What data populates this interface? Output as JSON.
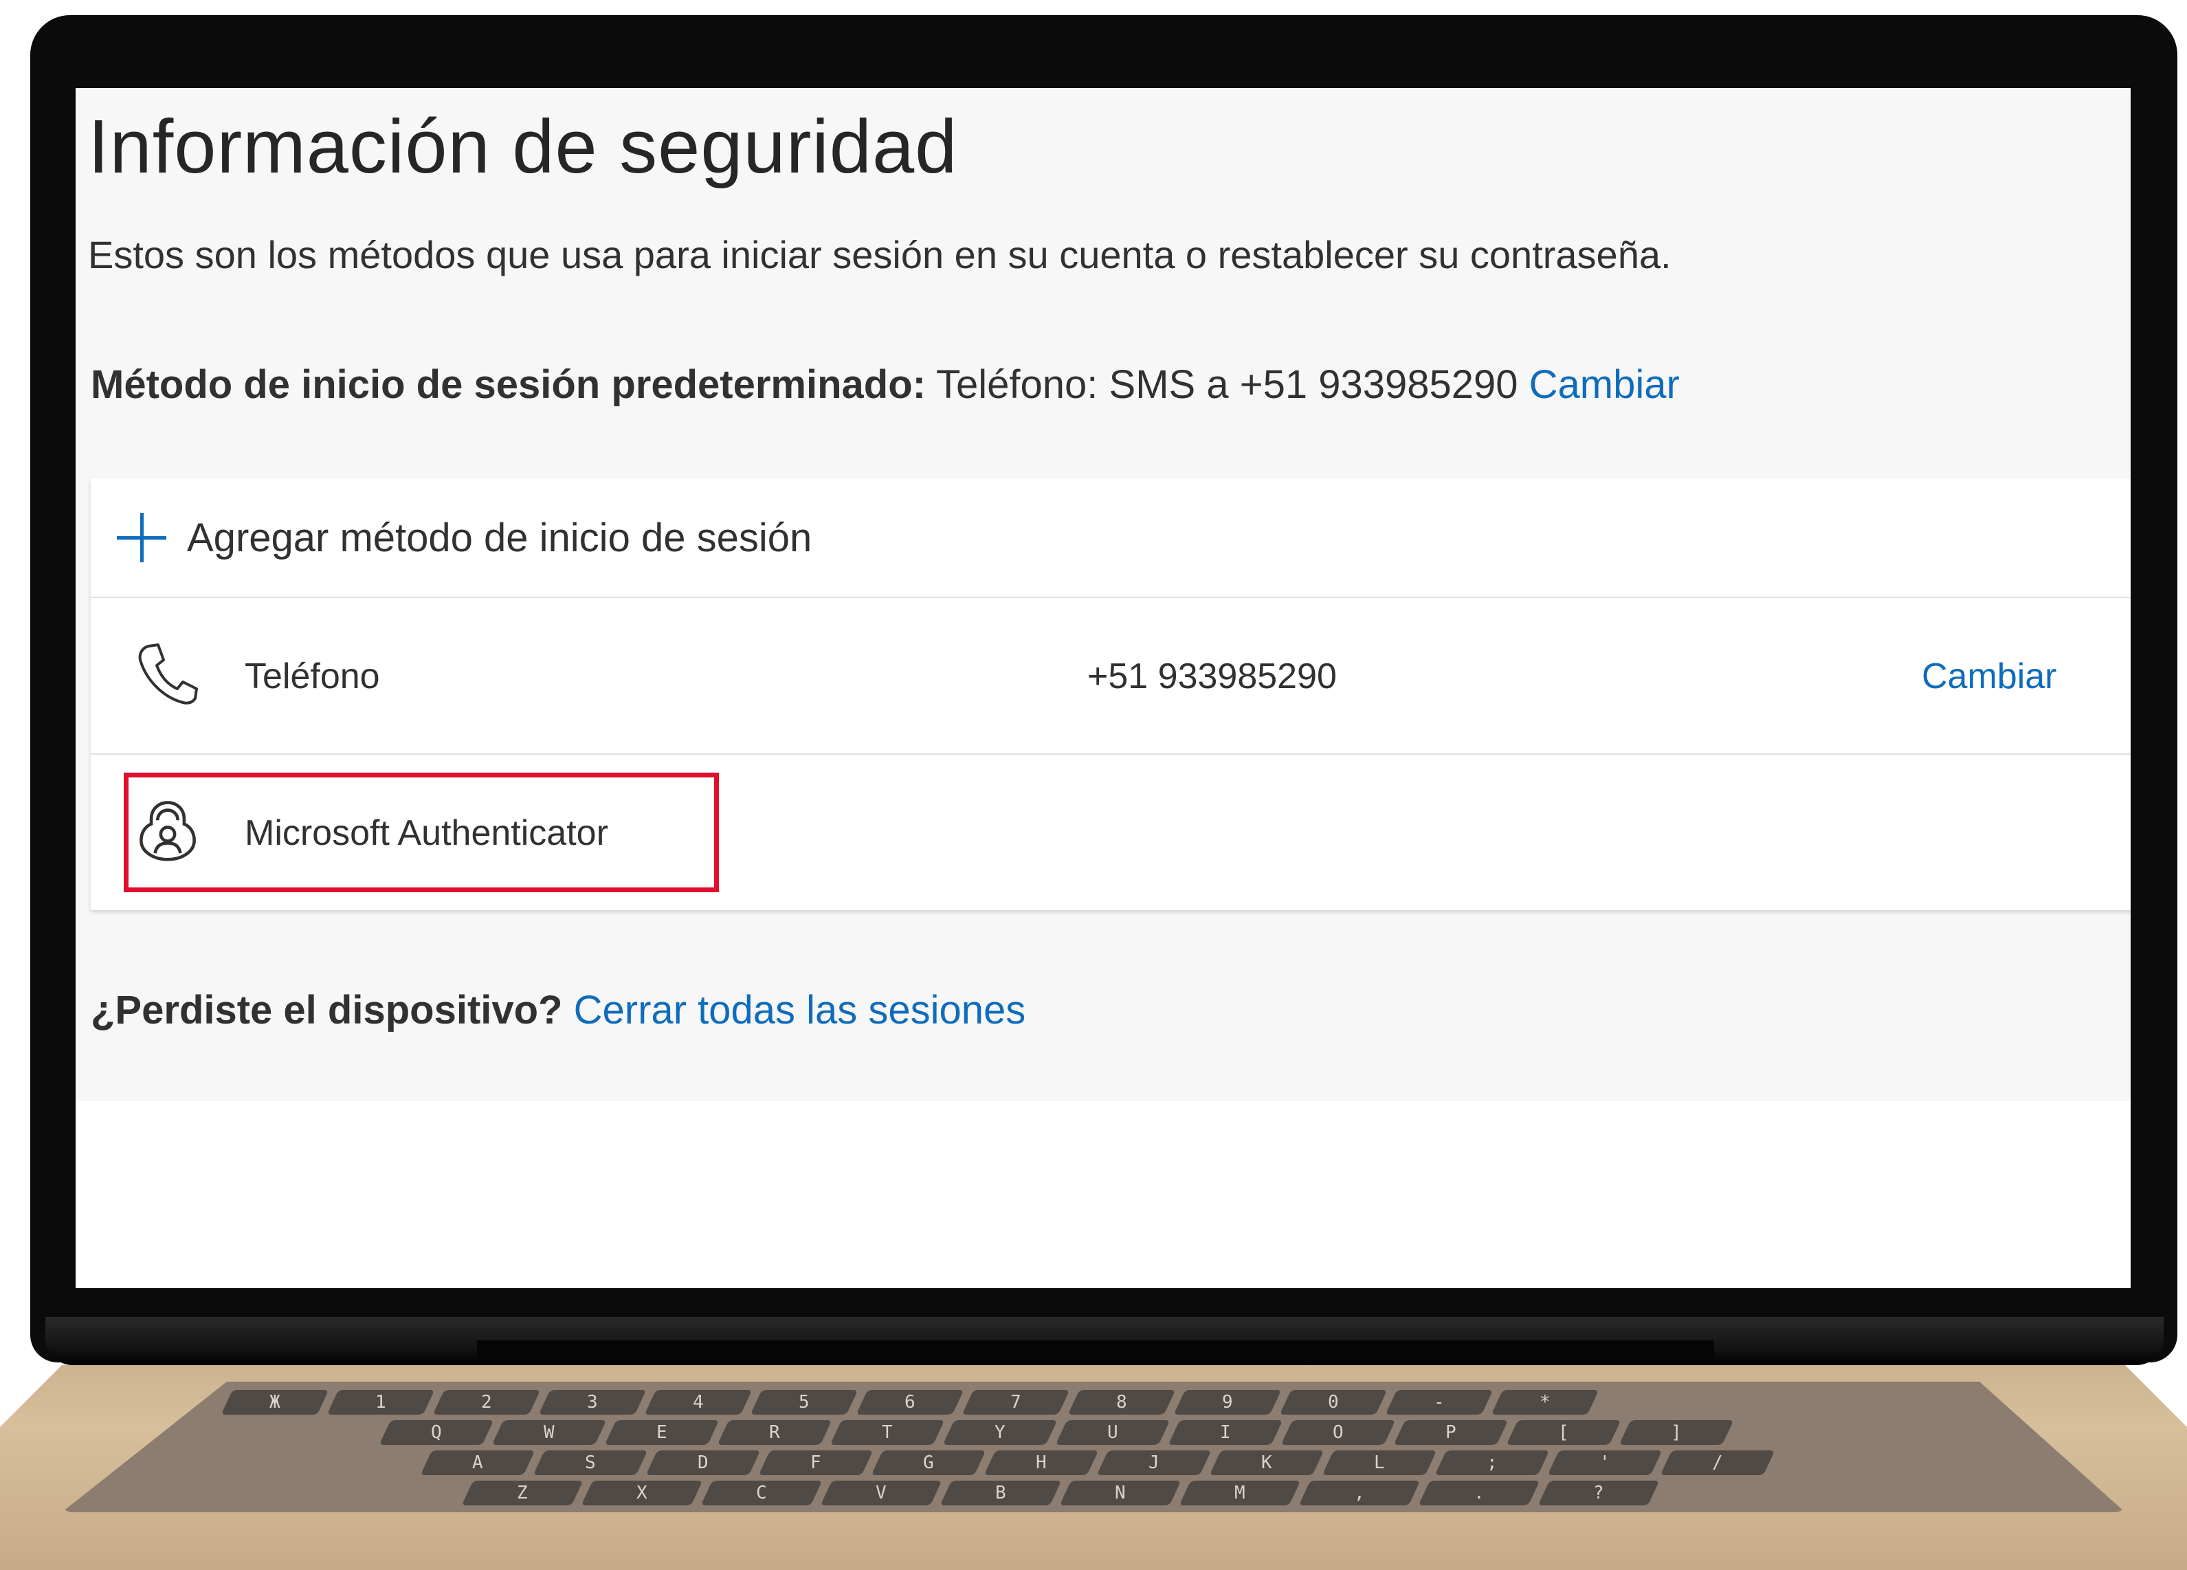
{
  "page": {
    "title": "Información de seguridad",
    "subtitle": "Estos son los métodos que usa para iniciar sesión en su cuenta o restablecer su contraseña.",
    "default_method": {
      "label": "Método de inicio de sesión predeterminado:",
      "value": " Teléfono: SMS a +51 933985290 ",
      "change_link": "Cambiar"
    },
    "add_method_label": "Agregar método de inicio de sesión",
    "methods": [
      {
        "icon": "phone-icon",
        "label": "Teléfono",
        "value": "+51 933985290",
        "action": "Cambiar"
      },
      {
        "icon": "authenticator-icon",
        "label": "Microsoft Authenticator",
        "value": "",
        "action": ""
      }
    ],
    "lost_device": {
      "question": "¿Perdiste el dispositivo?",
      "link": "Cerrar todas las sesiones"
    },
    "highlight_color": "#e10f2e",
    "link_color": "#0f6cbd"
  },
  "keyboard": {
    "row1": [
      "Ж",
      "1",
      "2",
      "3",
      "4",
      "5",
      "6",
      "7",
      "8",
      "9",
      "0",
      "-",
      "*"
    ],
    "row2": [
      "Q",
      "W",
      "E",
      "R",
      "T",
      "Y",
      "U",
      "I",
      "O",
      "P",
      "[",
      "]"
    ],
    "row3": [
      "A",
      "S",
      "D",
      "F",
      "G",
      "H",
      "J",
      "K",
      "L",
      ";",
      "'",
      "/"
    ],
    "row4": [
      "Z",
      "X",
      "C",
      "V",
      "B",
      "N",
      "M",
      ",",
      ".",
      "?"
    ]
  }
}
